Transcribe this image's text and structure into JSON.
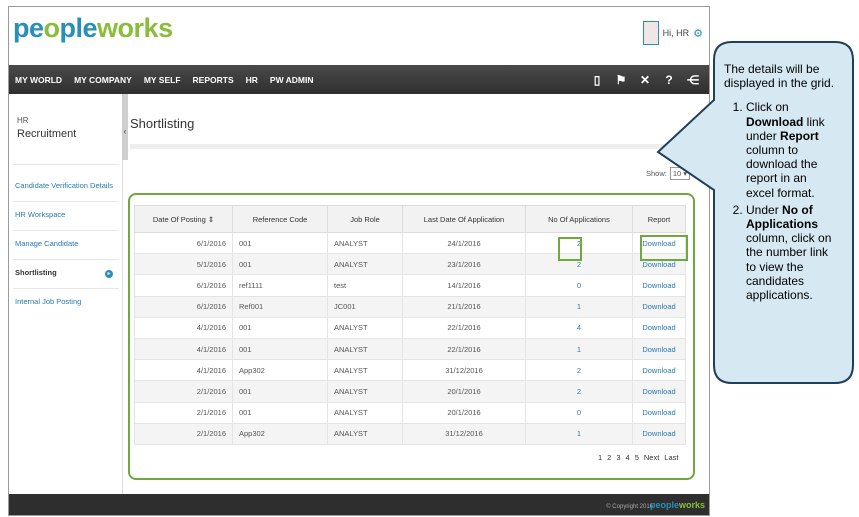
{
  "brand": {
    "logo_a": "pe",
    "logo_o": "o",
    "logo_b": "ple",
    "logo_c": "w",
    "logo_d": "o",
    "logo_e": "rks"
  },
  "user": {
    "name": "Hi, HR"
  },
  "nav": {
    "items": [
      "MY WORLD",
      "MY COMPANY",
      "MY SELF",
      "REPORTS",
      "HR",
      "PW ADMIN"
    ]
  },
  "sidebar": {
    "category": "HR",
    "title": "Recruitment",
    "items": [
      {
        "label": "Candidate Verification Details"
      },
      {
        "label": "HR Workspace"
      },
      {
        "label": "Manage Candidate"
      },
      {
        "label": "Shortlisting"
      },
      {
        "label": "Internal Job Posting"
      }
    ]
  },
  "main": {
    "title": "Shortlisting",
    "show_label": "Show:",
    "show_value": "10 ▾"
  },
  "table": {
    "headers": [
      "Date Of Posting",
      "Reference Code",
      "Job Role",
      "Last Date Of Application",
      "No Of Applications",
      "Report"
    ],
    "sort_glyph": "⇕",
    "rows": [
      [
        "6/1/2016",
        "001",
        "ANALYST",
        "24/1/2016",
        "2",
        "Download"
      ],
      [
        "5/1/2016",
        "001",
        "ANALYST",
        "23/1/2016",
        "2",
        "Download"
      ],
      [
        "6/1/2016",
        "ref1111",
        "test",
        "14/1/2016",
        "0",
        "Download"
      ],
      [
        "6/1/2016",
        "Ref001",
        "JC001",
        "21/1/2016",
        "1",
        "Download"
      ],
      [
        "4/1/2016",
        "001",
        "ANALYST",
        "22/1/2016",
        "4",
        "Download"
      ],
      [
        "4/1/2016",
        "001",
        "ANALYST",
        "22/1/2016",
        "1",
        "Download"
      ],
      [
        "4/1/2016",
        "App302",
        "ANALYST",
        "31/12/2016",
        "2",
        "Download"
      ],
      [
        "2/1/2016",
        "001",
        "ANALYST",
        "20/1/2016",
        "2",
        "Download"
      ],
      [
        "2/1/2016",
        "001",
        "ANALYST",
        "20/1/2016",
        "0",
        "Download"
      ],
      [
        "2/1/2016",
        "App302",
        "ANALYST",
        "31/12/2016",
        "1",
        "Download"
      ]
    ]
  },
  "pager": {
    "pages": [
      "1",
      "2",
      "3",
      "4",
      "5"
    ],
    "next": "Next",
    "last": "Last"
  },
  "footer": {
    "copyright": "© Copyright 2016",
    "logo_a": "people",
    "logo_b": "works"
  },
  "callout": {
    "intro": "The details will be displayed in the grid.",
    "step1_a": "Click on ",
    "step1_b": "Download",
    "step1_c": " link under ",
    "step1_d": "Report",
    "step1_e": " column to download the report in an excel format.",
    "step2_a": "Under ",
    "step2_b": "No of Applications",
    "step2_c": " column, click on the number link to view the candidates applications."
  },
  "colors": {
    "brand_blue": "#2a8fb8",
    "brand_green": "#8bbd3c",
    "highlight_green": "#6fa83e",
    "callout_fill": "#d6e9f2",
    "callout_border": "#1f3f5c"
  }
}
